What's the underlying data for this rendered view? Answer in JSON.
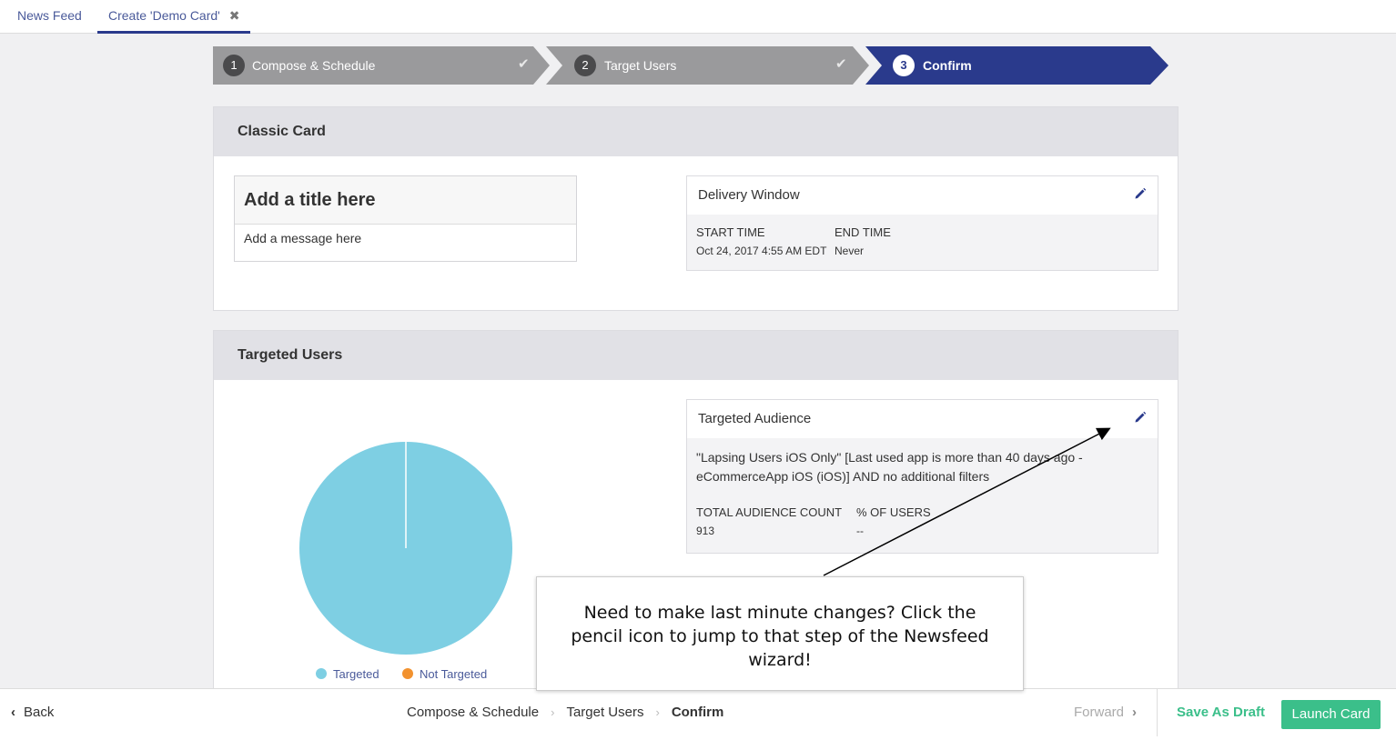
{
  "tabs": {
    "news_feed": "News Feed",
    "create": "Create 'Demo Card'",
    "close_icon": "close-icon"
  },
  "steps": [
    {
      "num": "1",
      "label": "Compose & Schedule",
      "state": "complete"
    },
    {
      "num": "2",
      "label": "Target Users",
      "state": "complete"
    },
    {
      "num": "3",
      "label": "Confirm",
      "state": "active"
    }
  ],
  "classic_card": {
    "heading": "Classic Card",
    "preview_title": "Add a title here",
    "preview_message": "Add a message here"
  },
  "delivery_window": {
    "heading": "Delivery Window",
    "start_label": "START TIME",
    "start_value": "Oct 24, 2017 4:55 AM EDT",
    "end_label": "END TIME",
    "end_value": "Never"
  },
  "targeted_users": {
    "heading": "Targeted Users",
    "legend": [
      {
        "label": "Targeted",
        "color": "#7ecfe3"
      },
      {
        "label": "Not Targeted",
        "color": "#f2922f"
      }
    ]
  },
  "chart_data": {
    "type": "pie",
    "slices": [
      {
        "label": "Targeted",
        "value": 100,
        "color": "#7ecfe3"
      },
      {
        "label": "Not Targeted",
        "value": 0,
        "color": "#f2922f"
      }
    ]
  },
  "targeted_audience": {
    "heading": "Targeted Audience",
    "description": "\"Lapsing Users iOS Only\" [Last used app is more than 40 days ago - eCommerceApp iOS (iOS)] AND no additional filters",
    "count_label": "TOTAL AUDIENCE COUNT",
    "count_value": "913",
    "pct_label": "% OF USERS",
    "pct_value": "--"
  },
  "callout": {
    "text": "Need to make last minute changes? Click the pencil icon to jump to that step of the Newsfeed wizard!"
  },
  "bottom": {
    "back": "Back",
    "crumbs": [
      "Compose & Schedule",
      "Target Users",
      "Confirm"
    ],
    "forward": "Forward",
    "save_draft": "Save As Draft",
    "launch": "Launch Card"
  },
  "colors": {
    "accent": "#2a3a8c",
    "step_complete": "#9a9a9c",
    "green": "#3bbf8a"
  }
}
